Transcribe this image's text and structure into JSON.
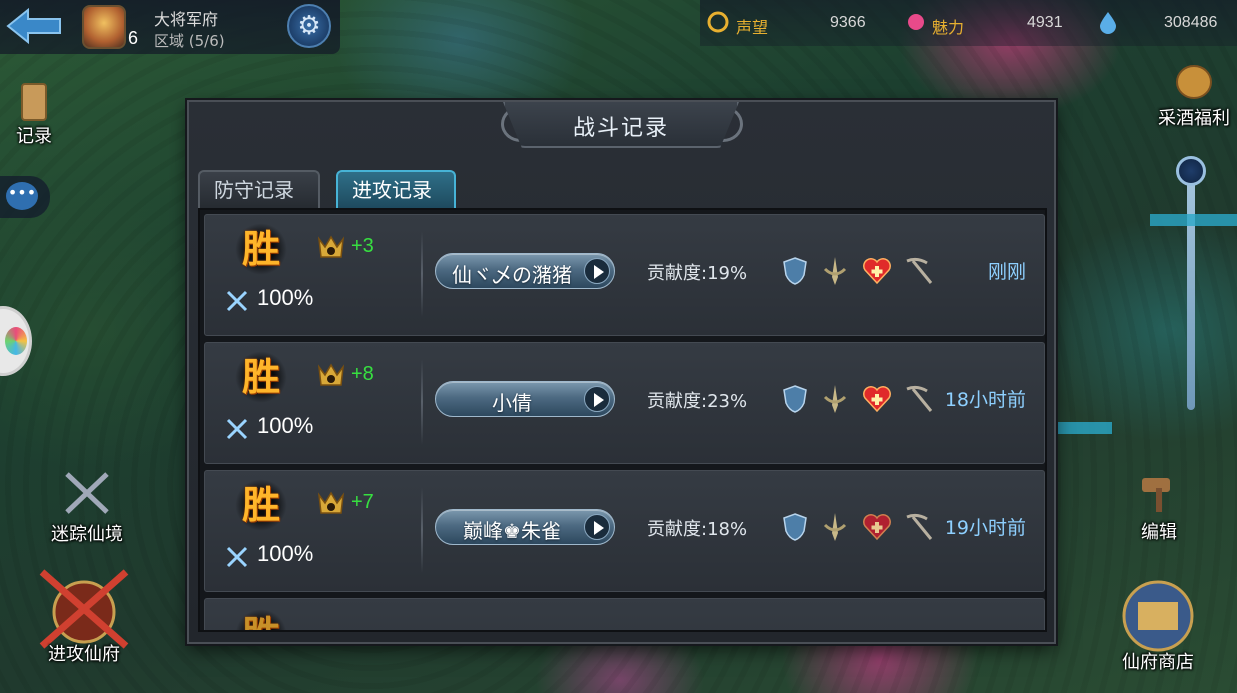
{
  "top_bar": {
    "home_level": "6",
    "home_name": "大将军府",
    "home_region": "区域 (5/6)",
    "stats": [
      {
        "label": "声望",
        "value": "9366",
        "icon": "laurel-icon"
      },
      {
        "label": "魅力",
        "value": "4931",
        "icon": "flower-icon"
      },
      {
        "label": "",
        "value": "308486",
        "icon": "water-drop-icon"
      }
    ]
  },
  "side_buttons": {
    "records": "记录",
    "wine_welfare": "采酒福利",
    "maze": "迷踪仙境",
    "edit": "编辑",
    "attack_palace": "进攻仙府",
    "palace_shop": "仙府商店"
  },
  "dialog": {
    "title": "战斗记录",
    "tabs": [
      {
        "label": "防守记录",
        "active": false
      },
      {
        "label": "进攻记录",
        "active": true
      }
    ],
    "records": [
      {
        "result": "胜",
        "rank_delta": "+3",
        "percent": "100%",
        "player": "仙ヾ乄の潴猪",
        "contribution": "贡献度:19%",
        "time": "刚刚"
      },
      {
        "result": "胜",
        "rank_delta": "+8",
        "percent": "100%",
        "player": "小倩",
        "contribution": "贡献度:23%",
        "time": "18小时前"
      },
      {
        "result": "胜",
        "rank_delta": "+7",
        "percent": "100%",
        "player": "巅峰♚朱雀",
        "contribution": "贡献度:18%",
        "time": "19小时前"
      }
    ]
  },
  "colors": {
    "win": "#ffb52a",
    "delta": "#37e040",
    "time": "#8ed0ff",
    "active_tab": "#47b3d6"
  }
}
